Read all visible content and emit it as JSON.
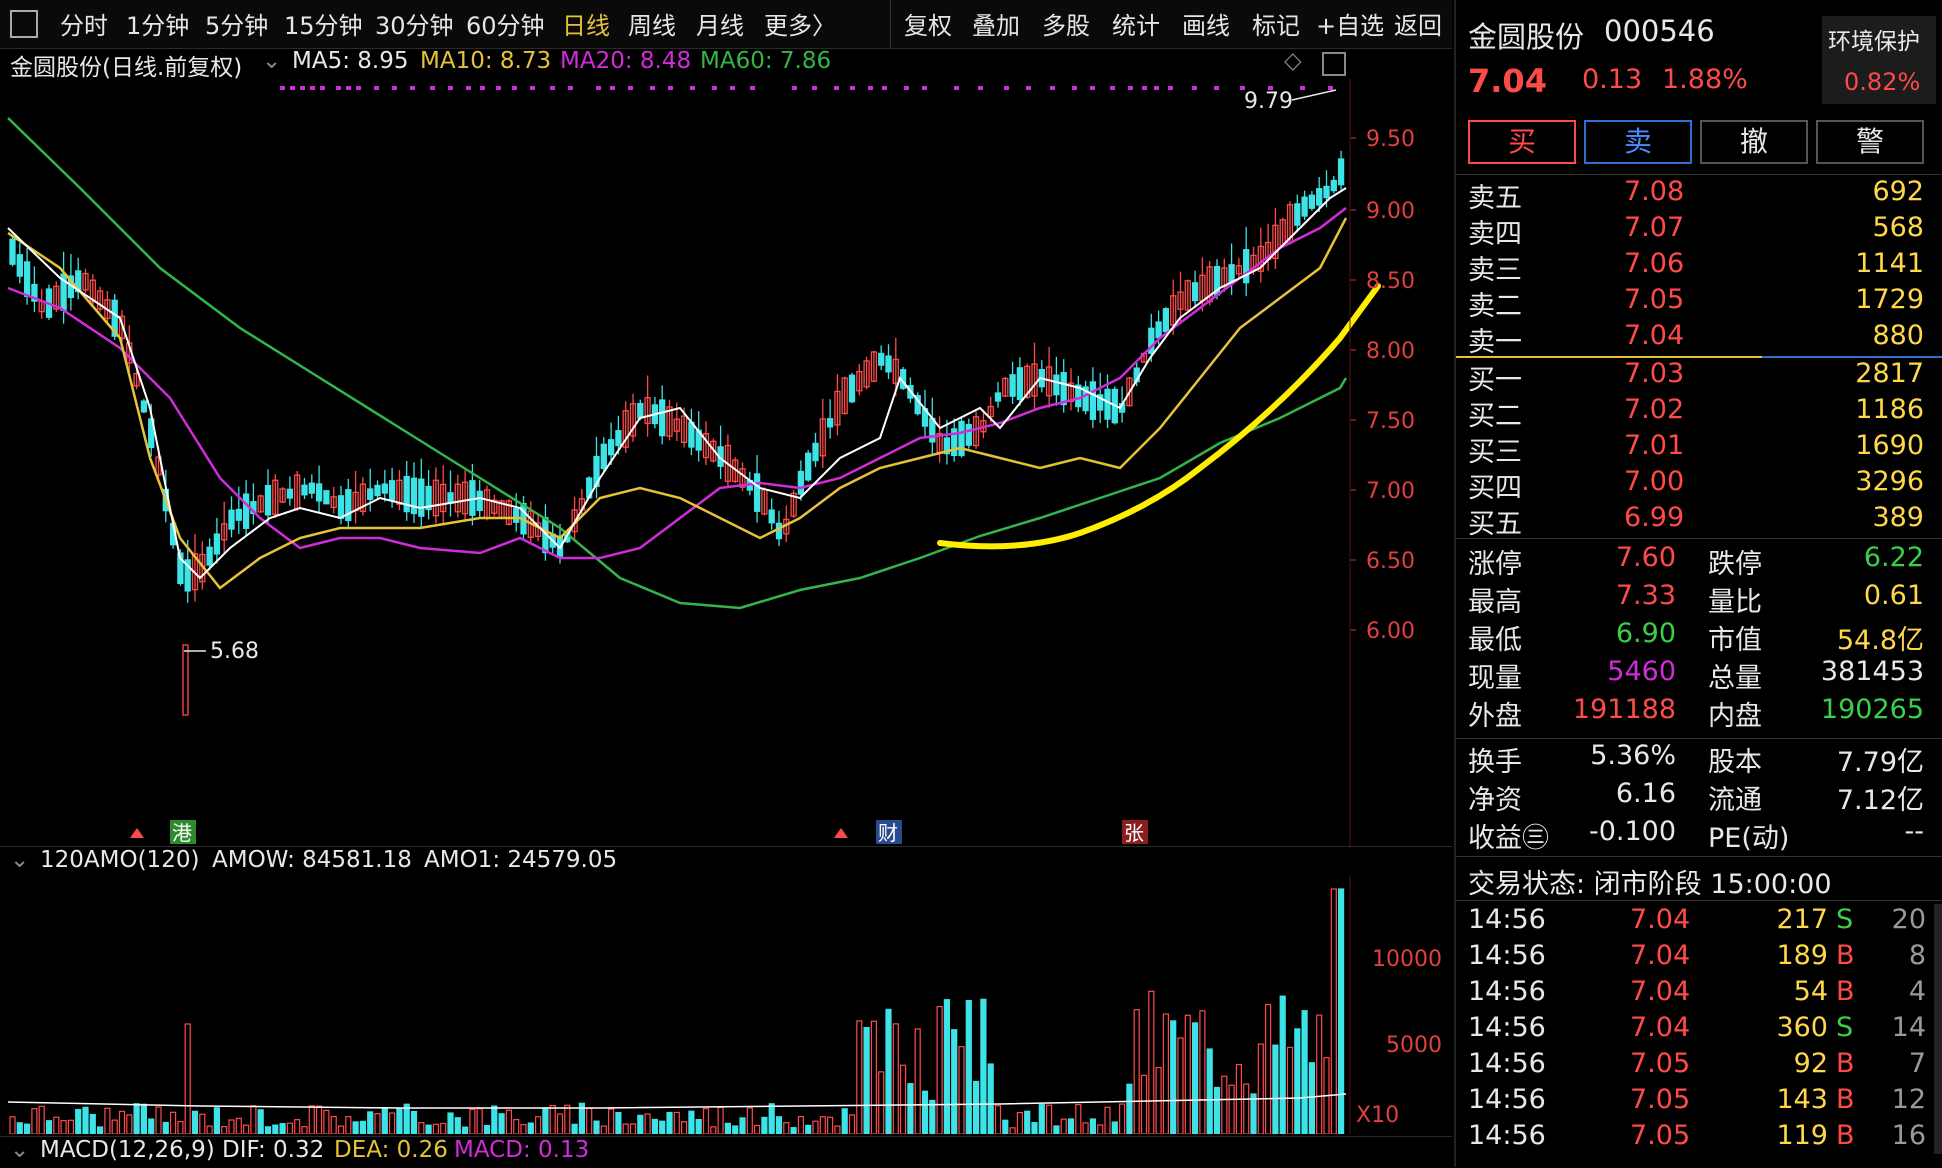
{
  "toolbar": {
    "periods": [
      "分时",
      "1分钟",
      "5分钟",
      "15分钟",
      "30分钟",
      "60分钟",
      "日线",
      "周线",
      "月线",
      "更多〉"
    ],
    "active_period": "日线",
    "actions": [
      "复权",
      "叠加",
      "多股",
      "统计",
      "画线",
      "标记",
      "+自选",
      "返回"
    ]
  },
  "kline_legend": {
    "title": "金圆股份(日线.前复权)",
    "ma5": "MA5: 8.95",
    "ma10": "MA10: 8.73",
    "ma20": "MA20: 8.48",
    "ma60": "MA60: 7.86"
  },
  "price_axis": [
    "9.50",
    "9.00",
    "8.50",
    "8.00",
    "7.50",
    "7.00",
    "6.50",
    "6.00"
  ],
  "high_label": "9.79",
  "low_label": "5.68",
  "event_markers": [
    "港",
    "财",
    "张"
  ],
  "volume_legend": {
    "title": "120AMO(120)",
    "amow": "AMOW: 84581.18",
    "amo1": "AMO1: 24579.05",
    "axis": [
      "10000",
      "5000"
    ],
    "unit": "X10"
  },
  "macd_legend": {
    "title": "MACD(12,26,9)",
    "dif": "DIF: 0.32",
    "dea": "DEA: 0.26",
    "macd": "MACD: 0.13"
  },
  "stock": {
    "name": "金圆股份",
    "code": "000546",
    "tag": "环境保护",
    "tag_change": "0.82%",
    "price": "7.04",
    "change": "0.13",
    "change_pct": "1.88%"
  },
  "order_buttons": [
    "买",
    "卖",
    "撤",
    "警"
  ],
  "asks": [
    {
      "label": "卖五",
      "price": "7.08",
      "vol": "692"
    },
    {
      "label": "卖四",
      "price": "7.07",
      "vol": "568"
    },
    {
      "label": "卖三",
      "price": "7.06",
      "vol": "1141"
    },
    {
      "label": "卖二",
      "price": "7.05",
      "vol": "1729"
    },
    {
      "label": "卖一",
      "price": "7.04",
      "vol": "880"
    }
  ],
  "bids": [
    {
      "label": "买一",
      "price": "7.03",
      "vol": "2817"
    },
    {
      "label": "买二",
      "price": "7.02",
      "vol": "1186"
    },
    {
      "label": "买三",
      "price": "7.01",
      "vol": "1690"
    },
    {
      "label": "买四",
      "price": "7.00",
      "vol": "3296"
    },
    {
      "label": "买五",
      "price": "6.99",
      "vol": "389"
    }
  ],
  "stats": [
    {
      "l1": "涨停",
      "v1": "7.60",
      "l2": "跌停",
      "v2": "6.22"
    },
    {
      "l1": "最高",
      "v1": "7.33",
      "l2": "量比",
      "v2": "0.61"
    },
    {
      "l1": "最低",
      "v1": "6.90",
      "l2": "市值",
      "v2": "54.8亿"
    },
    {
      "l1": "现量",
      "v1": "5460",
      "l2": "总量",
      "v2": "381453"
    },
    {
      "l1": "外盘",
      "v1": "191188",
      "l2": "内盘",
      "v2": "190265"
    }
  ],
  "stats2": [
    {
      "l1": "换手",
      "v1": "5.36%",
      "l2": "股本",
      "v2": "7.79亿"
    },
    {
      "l1": "净资",
      "v1": "6.16",
      "l2": "流通",
      "v2": "7.12亿"
    },
    {
      "l1": "收益㊂",
      "v1": "-0.100",
      "l2": "PE(动)",
      "v2": "--"
    }
  ],
  "trade_status": "交易状态: 闭市阶段 15:00:00",
  "ticks": [
    {
      "time": "14:56",
      "price": "7.04",
      "vol": "217",
      "side": "S",
      "num": "20"
    },
    {
      "time": "14:56",
      "price": "7.04",
      "vol": "189",
      "side": "B",
      "num": "8"
    },
    {
      "time": "14:56",
      "price": "7.04",
      "vol": "54",
      "side": "B",
      "num": "4"
    },
    {
      "time": "14:56",
      "price": "7.04",
      "vol": "360",
      "side": "S",
      "num": "14"
    },
    {
      "time": "14:56",
      "price": "7.05",
      "vol": "92",
      "side": "B",
      "num": "7"
    },
    {
      "time": "14:56",
      "price": "7.05",
      "vol": "143",
      "side": "B",
      "num": "12"
    },
    {
      "time": "14:56",
      "price": "7.05",
      "vol": "119",
      "side": "B",
      "num": "16"
    }
  ],
  "colors": {
    "up": "#ff4a4a",
    "down": "#3de3e6",
    "ma5": "#ffffff",
    "ma10": "#e6c23a",
    "ma20": "#d02cd8",
    "ma60": "#33b54a",
    "highlight": "#ffee00"
  }
}
